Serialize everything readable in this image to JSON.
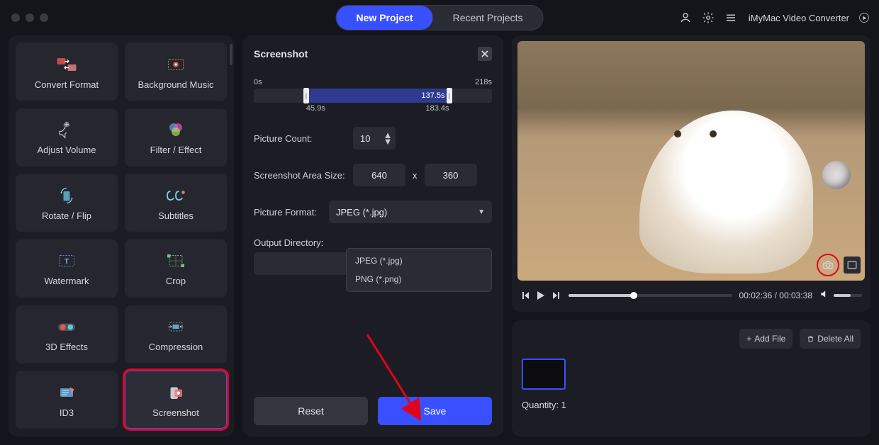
{
  "header": {
    "tabs": {
      "new": "New Project",
      "recent": "Recent Projects"
    },
    "brand": "iMyMac Video Converter"
  },
  "tools": [
    {
      "id": "convert-format",
      "label": "Convert Format"
    },
    {
      "id": "background-music",
      "label": "Background Music"
    },
    {
      "id": "adjust-volume",
      "label": "Adjust Volume"
    },
    {
      "id": "filter-effect",
      "label": "Filter / Effect"
    },
    {
      "id": "rotate-flip",
      "label": "Rotate / Flip"
    },
    {
      "id": "subtitles",
      "label": "Subtitles"
    },
    {
      "id": "watermark",
      "label": "Watermark"
    },
    {
      "id": "crop",
      "label": "Crop"
    },
    {
      "id": "3d-effects",
      "label": "3D Effects"
    },
    {
      "id": "compression",
      "label": "Compression"
    },
    {
      "id": "id3",
      "label": "ID3"
    },
    {
      "id": "screenshot",
      "label": "Screenshot"
    }
  ],
  "center": {
    "title": "Screenshot",
    "range": {
      "start_label": "0s",
      "end_label": "218s",
      "inner_label": "137.5s",
      "sel_start": "45.9s",
      "sel_end": "183.4s"
    },
    "picture_count_label": "Picture Count:",
    "picture_count_value": "10",
    "area_size_label": "Screenshot Area Size:",
    "area_w": "640",
    "area_h": "360",
    "area_sep": "x",
    "format_label": "Picture Format:",
    "format_value": "JPEG (*.jpg)",
    "format_options": [
      "JPEG (*.jpg)",
      "PNG (*.png)"
    ],
    "output_label": "Output Directory:",
    "reset": "Reset",
    "save": "Save"
  },
  "preview": {
    "time_current": "00:02:36",
    "time_total": "00:03:38"
  },
  "filelist": {
    "add": "Add File",
    "delete": "Delete All",
    "quantity_label": "Quantity:",
    "quantity_value": "1"
  }
}
